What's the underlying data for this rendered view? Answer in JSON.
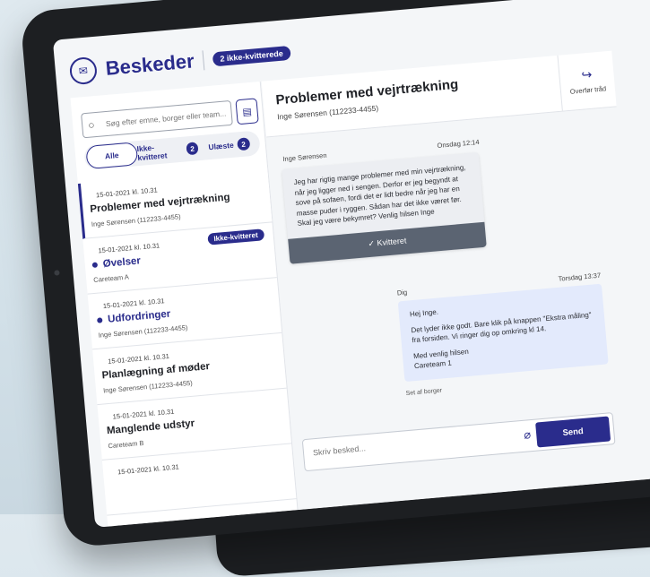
{
  "header": {
    "title": "Beskeder",
    "unacknowledged_badge": "2 ikke-kvitterede"
  },
  "search": {
    "placeholder": "Søg efter emne, borger eller team..."
  },
  "filters": {
    "all_label": "Alle",
    "unack_label": "Ikke-kvitteret",
    "unack_count": "2",
    "unread_label": "Ulæste",
    "unread_count": "2"
  },
  "threads": [
    {
      "date": "15-01-2021 kl. 10.31",
      "title": "Problemer med vejrtrækning",
      "sub": "Inge Sørensen (112233-4455)"
    },
    {
      "date": "15-01-2021 kl. 10.31",
      "title": "Øvelser",
      "sub": "Careteam A",
      "badge": "Ikke-kvitteret"
    },
    {
      "date": "15-01-2021 kl. 10.31",
      "title": "Udfordringer",
      "sub": "Inge Sørensen (112233-4455)"
    },
    {
      "date": "15-01-2021 kl. 10.31",
      "title": "Planlægning af møder",
      "sub": "Inge Sørensen (112233-4455)"
    },
    {
      "date": "15-01-2021 kl. 10.31",
      "title": "Manglende udstyr",
      "sub": "Careteam B"
    },
    {
      "date": "15-01-2021 kl. 10.31"
    }
  ],
  "conversation": {
    "title": "Problemer med vejrtrækning",
    "subtitle": "Inge Sørensen (112233-4455)",
    "forward_label": "Overfør tråd",
    "incoming": {
      "sender": "Inge Sørensen",
      "time": "Onsdag 12:14",
      "body": "Jeg har rigtig mange problemer med min vejrtrækning, når jeg ligger ned i sengen. Derfor er jeg begyndt at sove på sofaen, fordi det er lidt bedre når jeg har en masse puder i ryggen. Sådan har det ikke været før. Skal jeg være bekymret? Venlig hilsen Inge",
      "ack_label": "✓  Kvitteret"
    },
    "outgoing": {
      "sender": "Dig",
      "time": "Torsdag 13:37",
      "line1": "Hej Inge.",
      "line2": "Det lyder ikke godt. Bare klik på knappen \"Ekstra måling\" fra forsiden. Vi ringer dig op omkring kl 14.",
      "line3": "Med venlig hilsen",
      "line4": "Careteam 1",
      "seen": "Set af borger"
    },
    "composer_placeholder": "Skriv besked...",
    "send_label": "Send"
  },
  "colors": {
    "accent": "#2a2c8c",
    "outgoing_bubble": "#e3eafc",
    "ack_button": "#5b6472"
  }
}
